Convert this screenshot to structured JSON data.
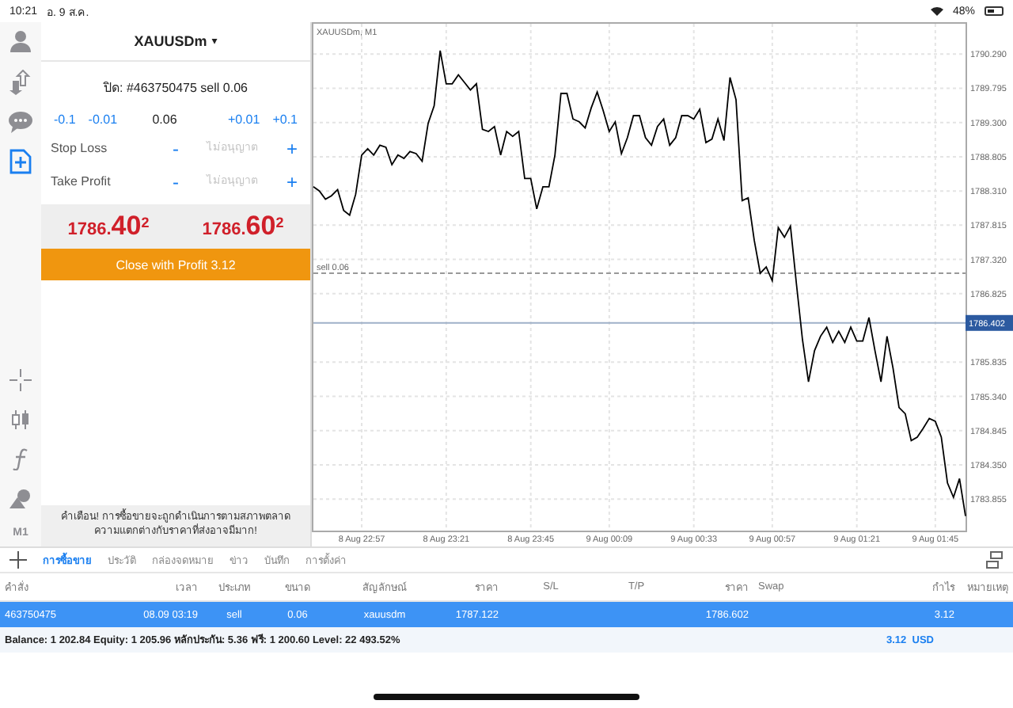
{
  "status_bar": {
    "time": "10:21",
    "date": "อ. 9 ส.ค.",
    "battery": "48%"
  },
  "toolbar_top": [
    {
      "kind": "person",
      "selected": false
    },
    {
      "kind": "arrows",
      "selected": false
    },
    {
      "kind": "chat",
      "selected": false
    },
    {
      "kind": "new-order",
      "selected": true
    }
  ],
  "toolbar_bottom": [
    {
      "kind": "crosshair"
    },
    {
      "kind": "candles"
    },
    {
      "kind": "function"
    },
    {
      "kind": "shapes"
    },
    {
      "kind": "text",
      "label": "M1"
    }
  ],
  "order_panel": {
    "symbol": "XAUUSDm",
    "dropdown": "▾",
    "position": "ปิด: #463750475 sell 0.06",
    "volume": {
      "steps_down": [
        "-0.1",
        "-0.01"
      ],
      "value": "0.06",
      "steps_up": [
        "+0.01",
        "+0.1"
      ]
    },
    "levels": [
      {
        "label": "Stop Loss",
        "minus": "-",
        "placeholder": "ไม่อนุญาต",
        "plus": "+"
      },
      {
        "label": "Take Profit",
        "minus": "-",
        "placeholder": "ไม่อนุญาต",
        "plus": "+"
      }
    ],
    "bid": {
      "main": "1786.",
      "big": "40",
      "sup": "2"
    },
    "ask": {
      "main": "1786.",
      "big": "60",
      "sup": "2"
    },
    "close_button": "Close with Profit 3.12"
  },
  "warning": {
    "lines": [
      "คำเตือน! การซื้อขายจะถูกดำเนินการตามสภาพตลาด",
      "ความแตกต่างกับราคาที่ส่งอาจมีมาก!"
    ]
  },
  "chart": {
    "chart_data": {
      "type": "line",
      "title": "XAUUSDm, M1",
      "grid": true,
      "ylim": [
        1783.4,
        1790.75
      ],
      "categories": [
        null,
        null,
        null,
        null,
        null,
        null,
        null,
        null,
        "8 Aug 22:57",
        null,
        null,
        null,
        null,
        null,
        null,
        null,
        null,
        null,
        null,
        null,
        null,
        null,
        "8 Aug 23:21",
        null,
        null,
        null,
        null,
        null,
        null,
        null,
        null,
        null,
        null,
        null,
        null,
        null,
        "8 Aug 23:45",
        null,
        null,
        null,
        null,
        null,
        null,
        null,
        null,
        null,
        null,
        null,
        null,
        "9 Aug 00:09",
        null,
        null,
        null,
        null,
        null,
        null,
        null,
        null,
        null,
        null,
        null,
        null,
        null,
        "9 Aug 00:33",
        null,
        null,
        null,
        null,
        null,
        null,
        null,
        null,
        null,
        null,
        null,
        null,
        "9 Aug 00:57",
        null,
        null,
        null,
        null,
        null,
        null,
        null,
        null,
        null,
        null,
        null,
        null,
        null,
        "9 Aug 01:21",
        null,
        null,
        null,
        null,
        null,
        null,
        null,
        null,
        null,
        null,
        null,
        null,
        "9 Aug 01:45",
        null,
        null,
        null,
        null,
        null
      ],
      "series": [
        {
          "color": "#000000",
          "values": [
            1788.37,
            1788.31,
            1788.19,
            1788.24,
            1788.33,
            1788.03,
            1787.96,
            1788.26,
            1788.83,
            1788.92,
            1788.83,
            1788.97,
            1788.94,
            1788.69,
            1788.83,
            1788.78,
            1788.88,
            1788.85,
            1788.74,
            1789.29,
            1789.54,
            1790.34,
            1789.86,
            1789.86,
            1789.99,
            1789.88,
            1789.77,
            1789.86,
            1789.2,
            1789.17,
            1789.24,
            1788.83,
            1789.17,
            1789.1,
            1789.17,
            1788.49,
            1788.49,
            1788.05,
            1788.37,
            1788.37,
            1788.83,
            1789.72,
            1789.72,
            1789.35,
            1789.31,
            1789.22,
            1789.51,
            1789.74,
            1789.47,
            1789.17,
            1789.31,
            1788.85,
            1789.08,
            1789.4,
            1789.4,
            1789.08,
            1788.97,
            1789.24,
            1789.35,
            1788.97,
            1789.08,
            1789.4,
            1789.4,
            1789.35,
            1789.49,
            1789.01,
            1789.06,
            1789.35,
            1789.04,
            1789.95,
            1789.63,
            1788.17,
            1788.21,
            1787.6,
            1787.12,
            1787.21,
            1787.01,
            1787.78,
            1787.64,
            1787.8,
            1786.96,
            1786.16,
            1785.55,
            1786.0,
            1786.21,
            1786.34,
            1786.12,
            1786.28,
            1786.12,
            1786.34,
            1786.14,
            1786.14,
            1786.48,
            1786.0,
            1785.55,
            1786.21,
            1785.75,
            1785.18,
            1785.09,
            1784.7,
            1784.75,
            1784.88,
            1785.02,
            1784.98,
            1784.75,
            1784.09,
            1783.88,
            1784.15,
            1783.61
          ]
        }
      ],
      "yticks": [
        {
          "value": 1790.29,
          "label": "1790.290"
        },
        {
          "value": 1789.795,
          "label": "1789.795"
        },
        {
          "value": 1789.3,
          "label": "1789.300"
        },
        {
          "value": 1788.805,
          "label": "1788.805"
        },
        {
          "value": 1788.31,
          "label": "1788.310"
        },
        {
          "value": 1787.815,
          "label": "1787.815"
        },
        {
          "value": 1787.32,
          "label": "1787.320"
        },
        {
          "value": 1786.825,
          "label": "1786.825"
        },
        {
          "value": 1785.835,
          "label": "1785.835"
        },
        {
          "value": 1785.34,
          "label": "1785.340"
        },
        {
          "value": 1784.845,
          "label": "1784.845"
        },
        {
          "value": 1784.35,
          "label": "1784.350"
        },
        {
          "value": 1783.855,
          "label": "1783.855"
        }
      ],
      "ref_lines": [
        {
          "axis": "y",
          "value": 1787.122,
          "label": "sell 0.06"
        },
        {
          "axis": "y",
          "value": 1786.402,
          "label": "1786.402"
        }
      ]
    }
  },
  "tabs": [
    {
      "label": "การซื้อขาย",
      "selected": true
    },
    {
      "label": "ประวัติ",
      "selected": false
    },
    {
      "label": "กล่องจดหมาย",
      "selected": false
    },
    {
      "label": "ข่าว",
      "selected": false
    },
    {
      "label": "บันทึก",
      "selected": false
    },
    {
      "label": "การตั้งค่า",
      "selected": false
    }
  ],
  "table": {
    "columns": [
      "คำสั่ง",
      "เวลา",
      "ประเภท",
      "ขนาด",
      "สัญลักษณ์",
      "ราคา",
      "S/L",
      "T/P",
      "ราคา",
      "Swap",
      "กำไร",
      "หมายเหตุ"
    ],
    "rows": [
      {
        "selected": true,
        "cells": [
          "463750475",
          "08.09 03:19",
          "sell",
          "0.06",
          "xauusdm",
          "1787.122",
          null,
          null,
          "1786.602",
          null,
          "3.12",
          null
        ]
      }
    ]
  },
  "summary": {
    "text": "Balance: 1 202.84 Equity: 1 205.96 หลักประกัน: 5.36 ฟรี: 1 200.60 Level: 22 493.52%",
    "profit": "3.12",
    "currency": "USD"
  }
}
